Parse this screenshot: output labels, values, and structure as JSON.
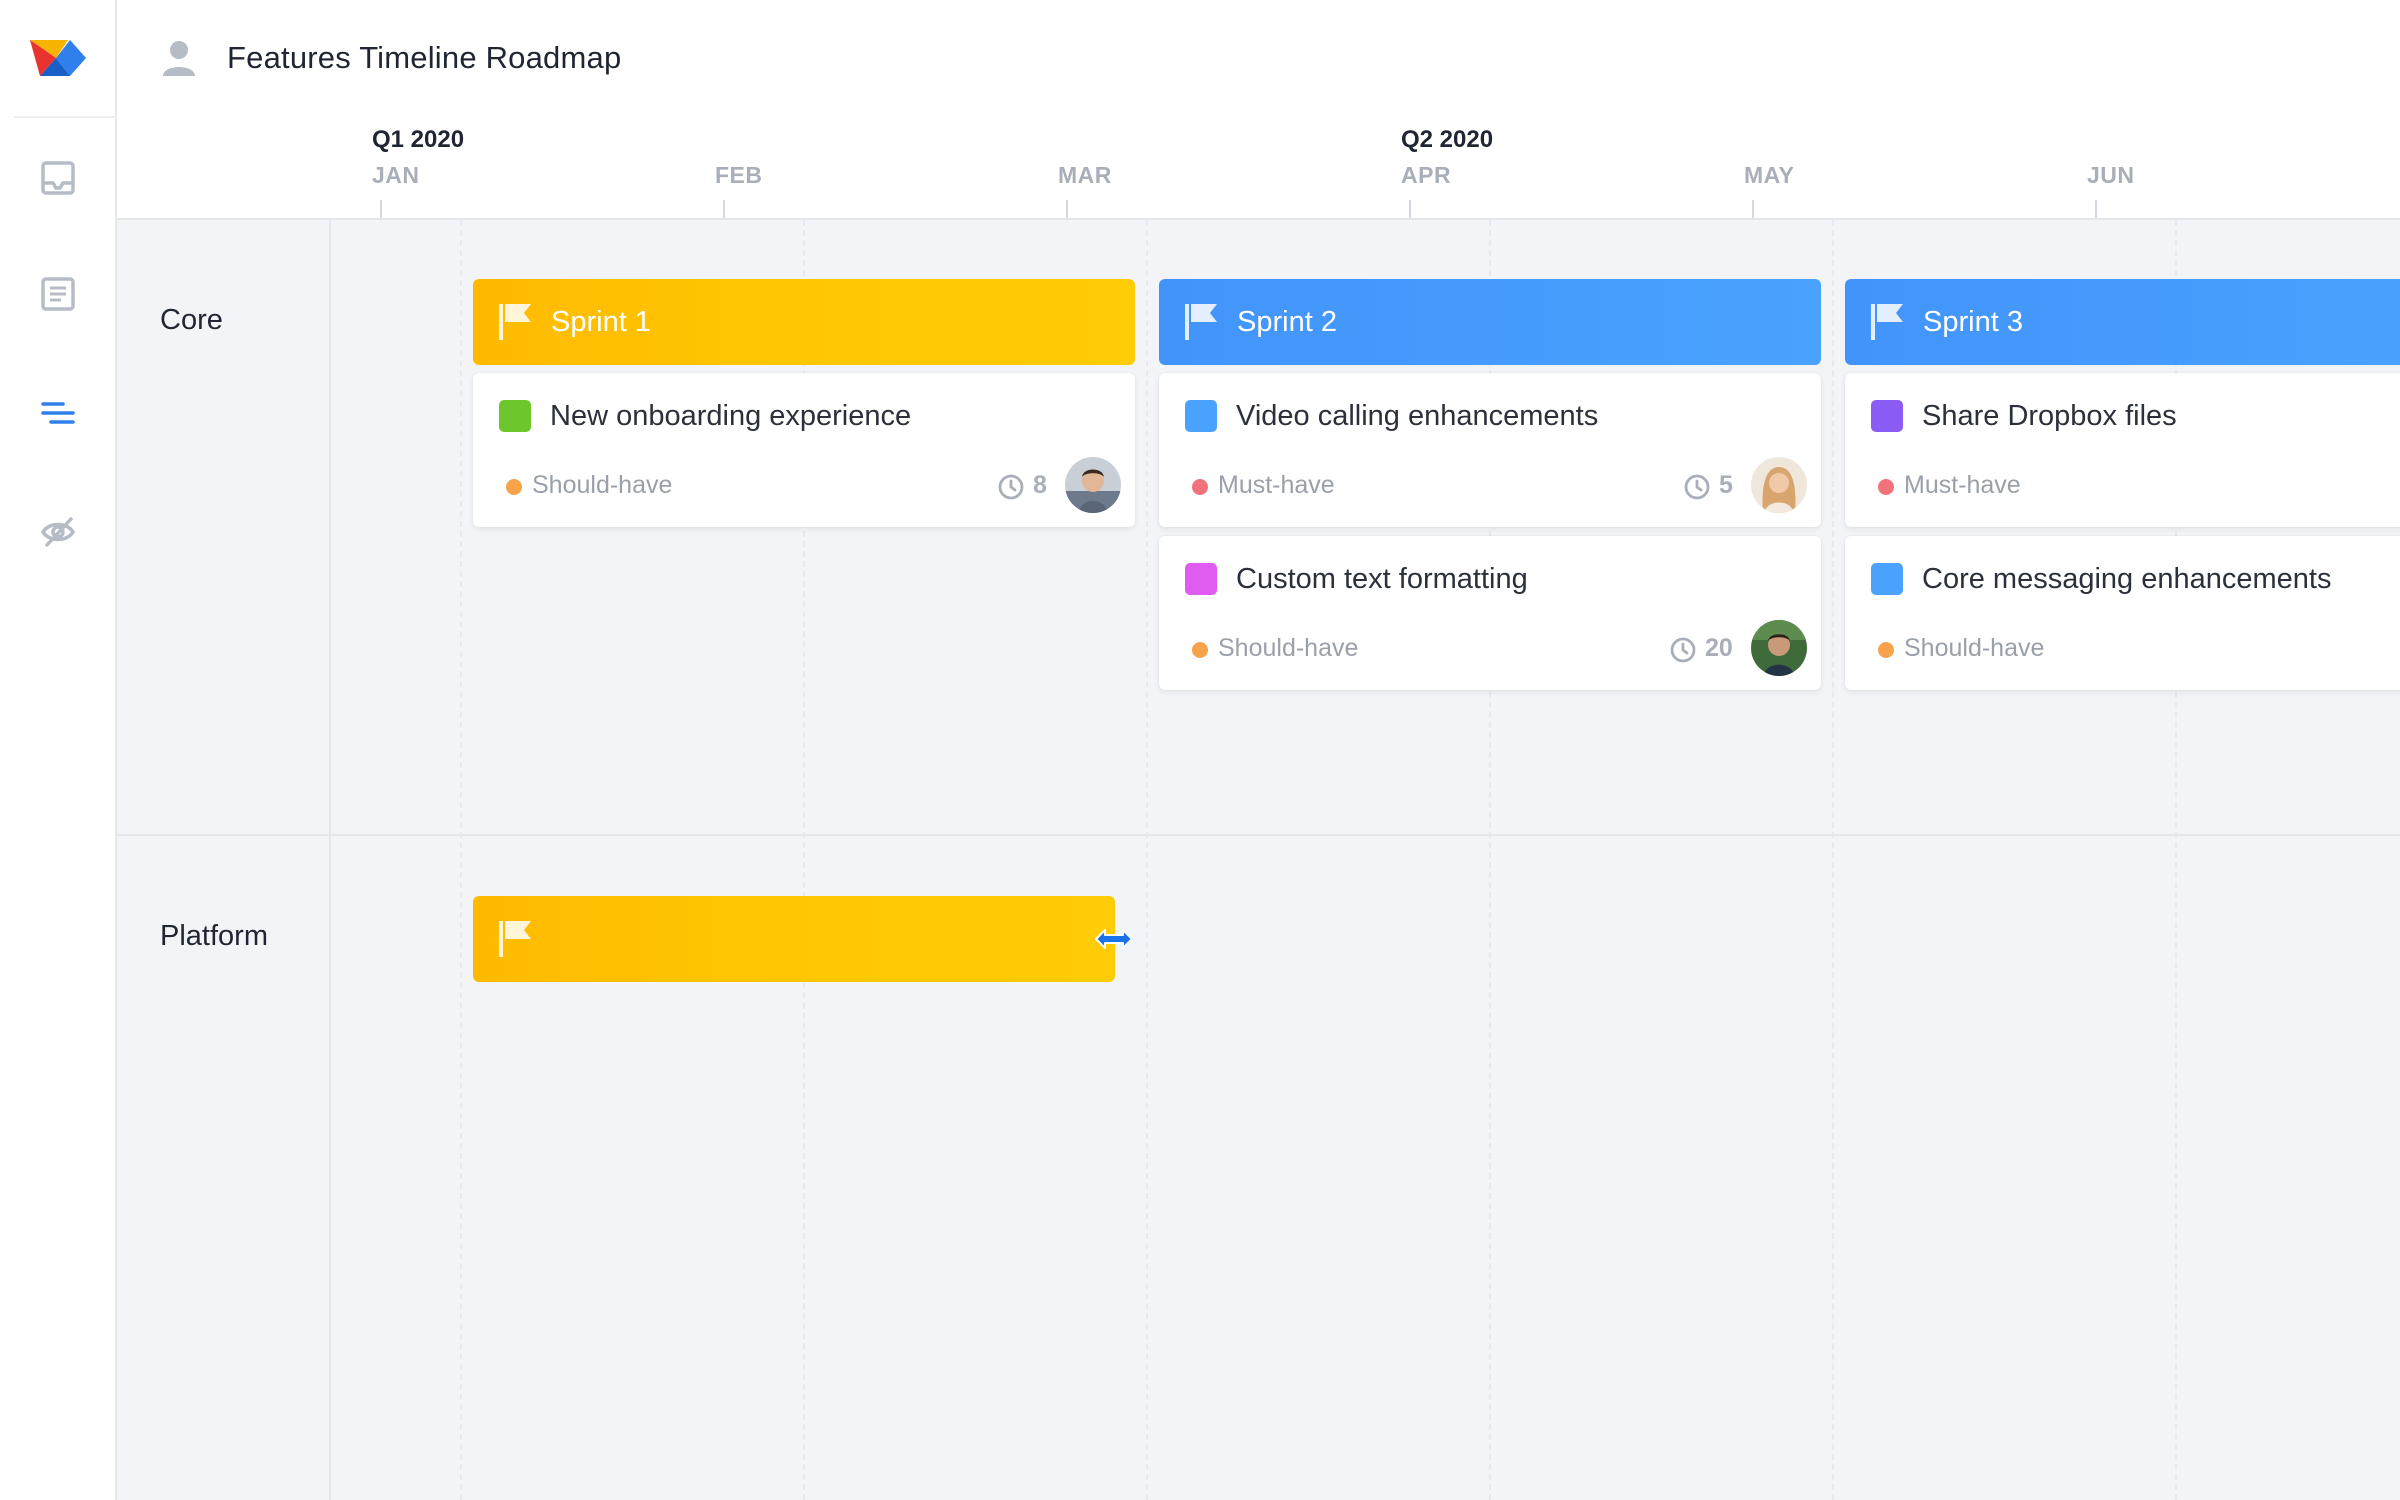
{
  "app": {
    "title": "Features Timeline Roadmap"
  },
  "nav": {
    "items": [
      {
        "icon": "inbox-icon"
      },
      {
        "icon": "document-icon"
      },
      {
        "icon": "roadmap-icon",
        "active": true
      },
      {
        "icon": "hidden-icon"
      }
    ]
  },
  "timeline": {
    "quarters": [
      "Q1 2020",
      "Q2 2020"
    ],
    "months": [
      "JAN",
      "FEB",
      "MAR",
      "APR",
      "MAY",
      "JUN"
    ]
  },
  "lanes": [
    {
      "name": "Core"
    },
    {
      "name": "Platform"
    }
  ],
  "sprints": [
    {
      "name": "Sprint 1"
    },
    {
      "name": "Sprint 2"
    },
    {
      "name": "Sprint 3"
    },
    {
      "name": ""
    }
  ],
  "cards": [
    {
      "title": "New onboarding experience",
      "priority": "Should-have",
      "estimate": "8",
      "color": "#6dc62b",
      "priority_color": "#f7a34b"
    },
    {
      "title": "Video calling enhancements",
      "priority": "Must-have",
      "estimate": "5",
      "color": "#4aa2fd",
      "priority_color": "#f2727c"
    },
    {
      "title": "Custom text formatting",
      "priority": "Should-have",
      "estimate": "20",
      "color": "#e05cf0",
      "priority_color": "#f7a34b"
    },
    {
      "title": "Share Dropbox files",
      "priority": "Must-have",
      "estimate": "",
      "color": "#8a5cf5",
      "priority_color": "#f2727c"
    },
    {
      "title": "Core messaging enhancements",
      "priority": "Should-have",
      "estimate": "",
      "color": "#4aa2fd",
      "priority_color": "#f7a34b"
    }
  ],
  "colors": {
    "sprint_yellow": "#ffc803",
    "sprint_blue": "#4aa2fd",
    "accent": "#2f80ed"
  }
}
